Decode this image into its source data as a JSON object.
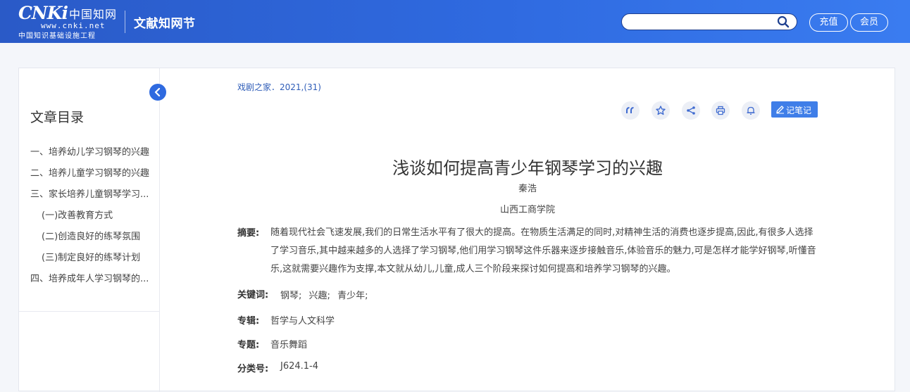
{
  "header": {
    "logo_mark": "CNKi",
    "logo_cn": "中国知网",
    "logo_url": "www.cnki.net",
    "logo_sub": "中国知识基础设施工程",
    "brand": "文献知网节",
    "search_value": "",
    "recharge": "充值",
    "member": "会员"
  },
  "toc": {
    "title": "文章目录",
    "items": [
      "一、培养幼儿学习钢琴的兴趣",
      "二、培养儿童学习钢琴的兴趣",
      "三、家长培养儿童钢琴学习...",
      "(一)改善教育方式",
      "(二)创造良好的练琴氛围",
      "(三)制定良好的练琴计划",
      "四、培养成年人学习钢琴的..."
    ]
  },
  "article": {
    "source": "戏剧之家．2021,(31)",
    "note_label": "记笔记",
    "title": "浅谈如何提高青少年钢琴学习的兴趣",
    "author": "秦浩",
    "affiliation": "山西工商学院",
    "abstract_label": "摘要:",
    "abstract": "随着现代社会飞速发展,我们的日常生活水平有了很大的提高。在物质生活满足的同时,对精神生活的消费也逐步提高,因此,有很多人选择了学习音乐,其中越来越多的人选择了学习钢琴,他们用学习钢琴这件乐器来逐步接触音乐,体验音乐的魅力,可是怎样才能学好钢琴,听懂音乐,这就需要兴趣作为支撑,本文就从幼儿,儿童,成人三个阶段来探讨如何提高和培养学习钢琴的兴趣。",
    "keywords_label": "关键词:",
    "keywords": [
      "钢琴;",
      "兴趣;",
      "青少年;"
    ],
    "series_label": "专辑:",
    "series": "哲学与人文科学",
    "topic_label": "专题:",
    "topic": "音乐舞蹈",
    "classno_label": "分类号:",
    "classno": "J624.1-4"
  },
  "icons": {
    "tools": [
      "quote-icon",
      "star-icon",
      "share-icon",
      "print-icon",
      "bell-icon"
    ],
    "accent": "#2f6ae0"
  }
}
